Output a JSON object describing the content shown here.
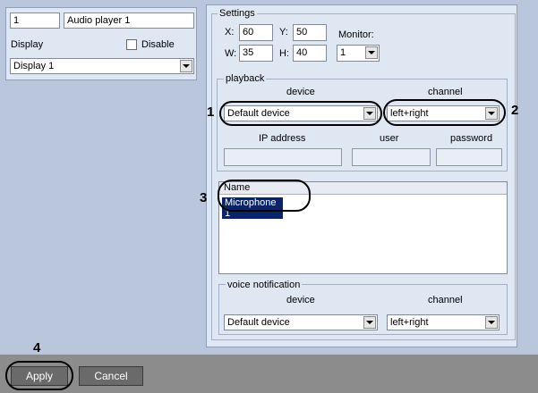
{
  "object": {
    "id": "1",
    "name": "Audio player 1",
    "display_label": "Display",
    "disable_label": "Disable",
    "display_value": "Display 1"
  },
  "settings": {
    "title": "Settings",
    "x_label": "X:",
    "x_value": "60",
    "y_label": "Y:",
    "y_value": "50",
    "w_label": "W:",
    "w_value": "35",
    "h_label": "H:",
    "h_value": "40",
    "monitor_label": "Monitor:",
    "monitor_value": "1"
  },
  "playback": {
    "title": "playback",
    "device_label": "device",
    "channel_label": "channel",
    "device_value": "Default device",
    "channel_value": "left+right",
    "ip_label": "IP address",
    "user_label": "user",
    "password_label": "password"
  },
  "microphones": {
    "header": "Name",
    "rows": [
      "Microphone 1"
    ]
  },
  "voice_notification": {
    "title": "voice notification",
    "device_label": "device",
    "channel_label": "channel",
    "device_value": "Default device",
    "channel_value": "left+right"
  },
  "callouts": [
    "1",
    "2",
    "3",
    "4"
  ],
  "footer": {
    "apply_label": "Apply",
    "cancel_label": "Cancel"
  }
}
